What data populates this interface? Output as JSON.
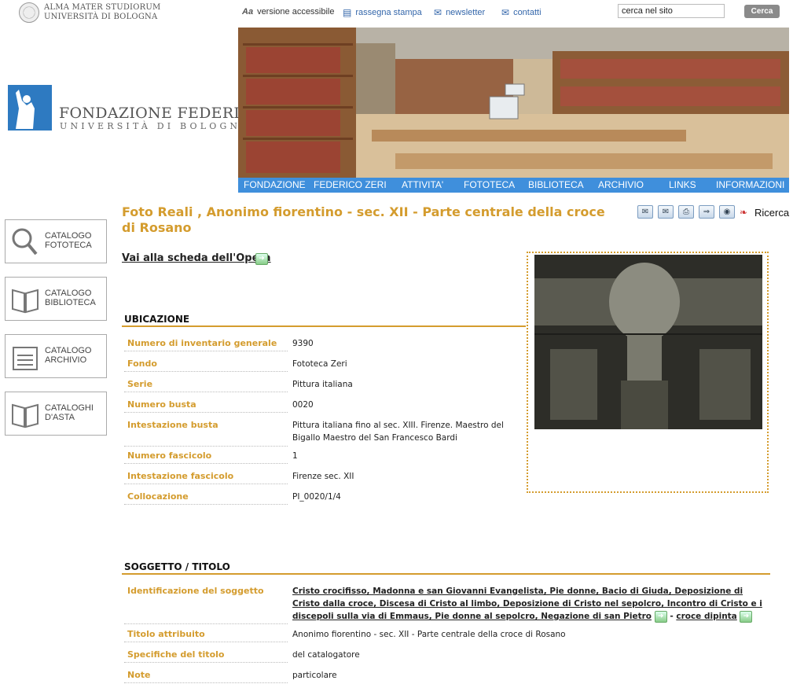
{
  "university": {
    "line1": "ALMA MATER STUDIORUM",
    "line2": "UNIVERSITÀ DI BOLOGNA"
  },
  "toplinks": {
    "access_icon": "Aa",
    "access": "versione accessibile",
    "press": "rassegna stampa",
    "newsletter": "newsletter",
    "contacts": "contatti"
  },
  "search": {
    "value": "cerca nel sito",
    "button": "Cerca"
  },
  "logo": {
    "title": "FONDAZIONE FEDERICO ZERI",
    "subtitle": "UNIVERSITÀ DI BOLOGNA"
  },
  "nav": [
    "FONDAZIONE",
    "FEDERICO ZERI",
    "ATTIVITA'",
    "FOTOTECA",
    "BIBLIOTECA",
    "ARCHIVIO",
    "LINKS",
    "INFORMAZIONI"
  ],
  "sidebar": [
    {
      "line1": "CATALOGO",
      "line2": "FOTOTECA",
      "icon": "magnifier-icon"
    },
    {
      "line1": "CATALOGO",
      "line2": "BIBLIOTECA",
      "icon": "book-icon"
    },
    {
      "line1": "CATALOGO",
      "line2": "ARCHIVIO",
      "icon": "folder-icon"
    },
    {
      "line1": "CATALOGHI",
      "line2": "D'ASTA",
      "icon": "book-icon"
    }
  ],
  "page": {
    "title": "Foto Reali , Anonimo fiorentino - sec. XII - Parte centrale della croce di Rosano",
    "ricerca": "Ricerca",
    "opera_link": "Vai alla scheda dell'Opera"
  },
  "ubicazione": {
    "heading": "UBICAZIONE",
    "rows": [
      {
        "k": "Numero di inventario generale",
        "v": "9390"
      },
      {
        "k": "Fondo",
        "v": "Fototeca Zeri"
      },
      {
        "k": "Serie",
        "v": "Pittura italiana"
      },
      {
        "k": "Numero busta",
        "v": "0020"
      },
      {
        "k": "Intestazione busta",
        "v": "Pittura italiana fino al sec. XIII. Firenze. Maestro del Bigallo Maestro del San Francesco Bardi"
      },
      {
        "k": "Numero fascicolo",
        "v": "1"
      },
      {
        "k": "Intestazione fascicolo",
        "v": "Firenze sec. XII"
      },
      {
        "k": "Collocazione",
        "v": "PI_0020/1/4"
      }
    ]
  },
  "soggetto": {
    "heading": "SOGGETTO / TITOLO",
    "identificazione_label": "Identificazione del soggetto",
    "identificazione_value": "Cristo crocifisso, Madonna e san Giovanni Evangelista, Pie donne, Bacio di Giuda, Deposizione di Cristo dalla croce, Discesa di Cristo al limbo, Deposizione di Cristo nel sepolcro, Incontro di Cristo e i discepoli sulla via di Emmaus, Pie donne al sepolcro, Negazione di san Pietro",
    "identificazione_sep": " - ",
    "identificazione_extra": "croce dipinta",
    "rows": [
      {
        "k": "Titolo attribuito",
        "v": "Anonimo fiorentino - sec. XII - Parte centrale della croce di Rosano"
      },
      {
        "k": "Specifiche del titolo",
        "v": "del catalogatore"
      },
      {
        "k": "Note",
        "v": "particolare"
      }
    ]
  },
  "colors": {
    "accent": "#d49c2e",
    "nav": "#3f8fdc",
    "link": "#3366aa"
  }
}
